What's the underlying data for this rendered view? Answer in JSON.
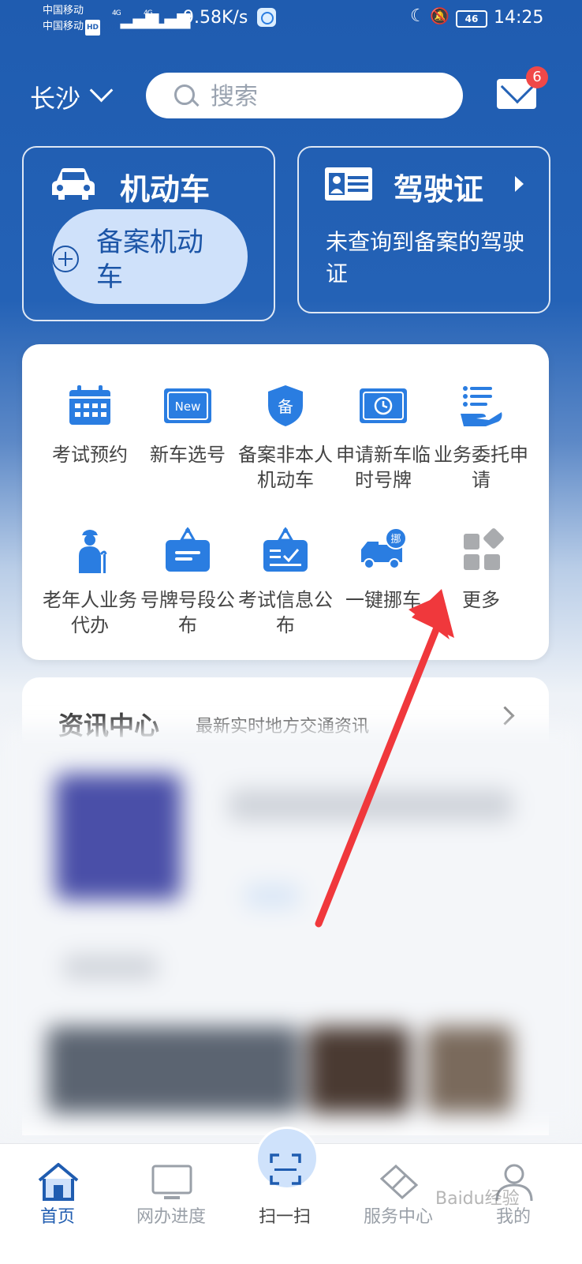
{
  "status_bar": {
    "carrier_1": "中国移动",
    "carrier_2": "中国移动",
    "hd": "HD",
    "net_1": "4G",
    "net_2": "4G",
    "speed": "9.58K/s",
    "battery": "46",
    "time": "14:25"
  },
  "header": {
    "city": "长沙",
    "search_placeholder": "搜索",
    "mail_badge": "6"
  },
  "vehicle_card": {
    "title": "机动车",
    "register_label": "备案机动车"
  },
  "license_card": {
    "title": "驾驶证",
    "description": "未查询到备案的驾驶证"
  },
  "services": [
    {
      "label": "考试预约",
      "icon": "calendar-icon"
    },
    {
      "label": "新车选号",
      "icon": "new-plate-icon"
    },
    {
      "label": "备案非本人机动车",
      "icon": "shield-icon"
    },
    {
      "label": "申请新车临时号牌",
      "icon": "temp-plate-icon"
    },
    {
      "label": "业务委托申请",
      "icon": "hand-list-icon"
    },
    {
      "label": "老年人业务代办",
      "icon": "elderly-icon"
    },
    {
      "label": "号牌号段公布",
      "icon": "sign-board-icon"
    },
    {
      "label": "考试信息公布",
      "icon": "check-board-icon"
    },
    {
      "label": "一键挪车",
      "icon": "truck-icon"
    },
    {
      "label": "更多",
      "icon": "grid-more-icon"
    }
  ],
  "truck_badge": "挪",
  "new_badge": "New",
  "shield_char": "备",
  "news": {
    "title": "资讯中心",
    "subtitle": "最新实时地方交通资讯"
  },
  "bottom_nav": [
    {
      "label": "首页",
      "icon": "home-icon",
      "active": true
    },
    {
      "label": "网办进度",
      "icon": "monitor-icon",
      "active": false
    },
    {
      "label": "扫一扫",
      "icon": "scan-icon",
      "active": false
    },
    {
      "label": "服务中心",
      "icon": "service-icon",
      "active": false
    },
    {
      "label": "我的",
      "icon": "profile-icon",
      "active": false
    }
  ],
  "watermark": "Baidu经验",
  "colors": {
    "primary": "#1f5cb0",
    "accent_icon": "#2a7de1",
    "badge": "#f04848",
    "annotation_arrow": "#f0383c"
  }
}
